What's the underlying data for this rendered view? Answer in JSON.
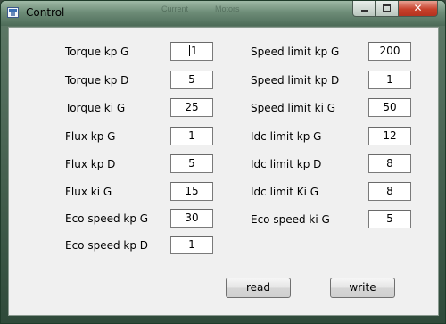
{
  "window": {
    "title": "Control",
    "background_ghost_text": [
      "Current",
      "Motors"
    ]
  },
  "left_params": [
    {
      "label": "Torque kp G",
      "value": "1"
    },
    {
      "label": "Torque kp D",
      "value": "5"
    },
    {
      "label": "Torque ki G",
      "value": "25"
    },
    {
      "label": "Flux kp G",
      "value": "1"
    },
    {
      "label": "Flux kp D",
      "value": "5"
    },
    {
      "label": "Flux ki G",
      "value": "15"
    },
    {
      "label": "Eco speed kp G",
      "value": "30"
    },
    {
      "label": "Eco speed kp D",
      "value": "1"
    }
  ],
  "right_params": [
    {
      "label": "Speed limit kp G",
      "value": "200"
    },
    {
      "label": "Speed limit kp D",
      "value": "1"
    },
    {
      "label": "Speed limit ki G",
      "value": "50"
    },
    {
      "label": "Idc limit kp G",
      "value": "12"
    },
    {
      "label": "Idc limit kp D",
      "value": "8"
    },
    {
      "label": "Idc limit Ki G",
      "value": "8"
    },
    {
      "label": "Eco speed ki G",
      "value": "5"
    }
  ],
  "buttons": {
    "read": "read",
    "write": "write"
  },
  "icons": {
    "app": "window-app-icon",
    "minimize": "minimize-icon",
    "maximize": "maximize-icon",
    "close": "close-icon"
  },
  "colors": {
    "client_bg": "#f0f0f0",
    "close_button": "#c7412b",
    "titlebar": "#6e8d78"
  }
}
